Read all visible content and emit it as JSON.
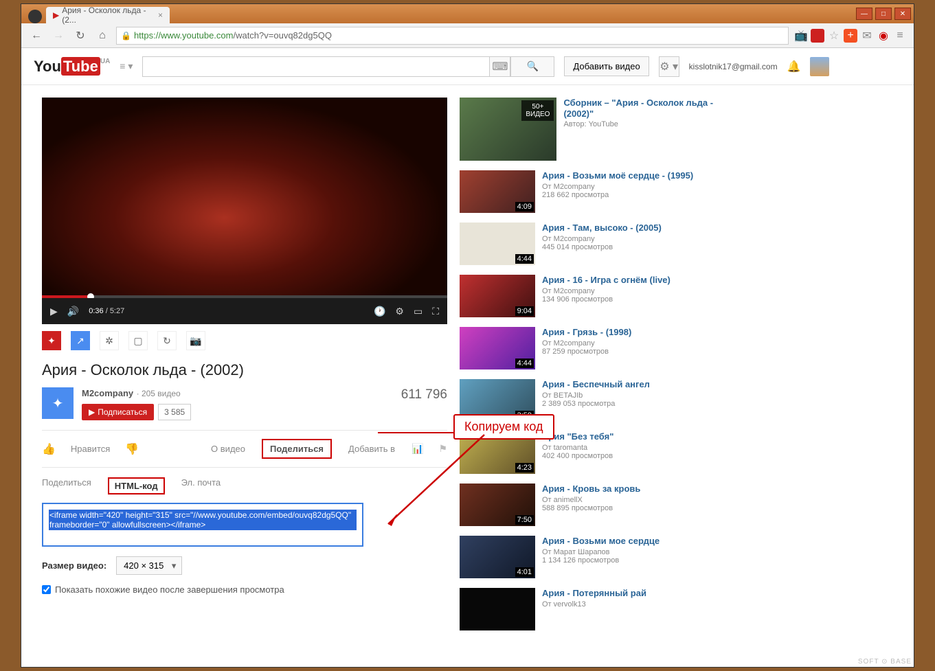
{
  "browser": {
    "tab_title": "Ария - Осколок льда - (2...",
    "url_protocol": "https",
    "url_domain": "://www.youtube.com",
    "url_path": "/watch?v=ouvq82dg5QQ"
  },
  "header": {
    "logo_you": "You",
    "logo_tube": "Tube",
    "region": "UA",
    "upload_label": "Добавить видео",
    "user_email": "kisslotnik17@gmail.com"
  },
  "player": {
    "current_time": "0:36",
    "duration": "5:27"
  },
  "video": {
    "title": "Ария - Осколок льда - (2002)",
    "channel": "M2company",
    "channel_videos": "205 видео",
    "subscribe_label": "Подписаться",
    "subscriber_count": "3 585",
    "view_count": "611 796",
    "like_label": "Нравится",
    "about_label": "О видео",
    "share_label": "Поделиться",
    "add_to_label": "Добавить в"
  },
  "share": {
    "tab_share": "Поделиться",
    "tab_html": "HTML-код",
    "tab_email": "Эл. почта",
    "embed_code": "<iframe width=\"420\" height=\"315\" src=\"//www.youtube.com/embed/ouvq82dg5QQ\" frameborder=\"0\" allowfullscreen></iframe>",
    "size_label": "Размер видео:",
    "size_value": "420 × 315",
    "checkbox_label": "Показать похожие видео после завершения просмотра"
  },
  "callout": "Копируем код",
  "recommendations": [
    {
      "title": "Сборник – \"Ария - Осколок льда - (2002)\"",
      "by": "Автор: YouTube",
      "views": "",
      "time": "",
      "badge": "50+\nВИДЕО"
    },
    {
      "title": "Ария - Возьми моё сердце - (1995)",
      "by": "От M2company",
      "views": "218 662 просмотра",
      "time": "4:09"
    },
    {
      "title": "Ария - Там, высоко - (2005)",
      "by": "От M2company",
      "views": "445 014 просмотров",
      "time": "4:44"
    },
    {
      "title": "Ария - 16 - Игра с огнём (live)",
      "by": "От M2company",
      "views": "134 906 просмотров",
      "time": "9:04"
    },
    {
      "title": "Ария - Грязь - (1998)",
      "by": "От M2company",
      "views": "87 259 просмотров",
      "time": "4:44"
    },
    {
      "title": "Ария - Беспечный ангел",
      "by": "От BETAJIb",
      "views": "2 389 053 просмотра",
      "time": "3:59"
    },
    {
      "title": "Ария \"Без тебя\"",
      "by": "От taromanta",
      "views": "402 400 просмотров",
      "time": "4:23"
    },
    {
      "title": "Ария - Кровь за кровь",
      "by": "От animellX",
      "views": "588 895 просмотров",
      "time": "7:50"
    },
    {
      "title": "Ария - Возьми мое сердце",
      "by": "От Марат Шарапов",
      "views": "1 134 126 просмотров",
      "time": "4:01"
    },
    {
      "title": "Ария - Потерянный рай",
      "by": "От vervolk13",
      "views": "",
      "time": ""
    }
  ],
  "watermark": "SOFT ⊙ BASE"
}
